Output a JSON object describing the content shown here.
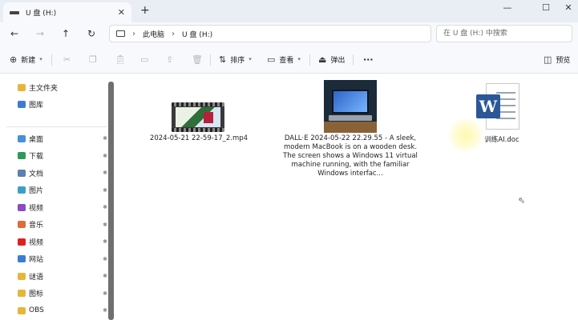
{
  "tab": {
    "title": "U 盘 (H:)",
    "close": "✕",
    "new_tab": "+"
  },
  "window_controls": {
    "minimize": "—",
    "maximize": "☐",
    "close": "✕"
  },
  "nav": {
    "back": "←",
    "forward": "→",
    "up": "↑",
    "refresh": "↻"
  },
  "address": {
    "crumbs": [
      "此电脑",
      "U 盘 (H:)"
    ],
    "chevron": "›"
  },
  "search": {
    "placeholder": "在 U 盘 (H:) 中搜索"
  },
  "commands": {
    "new_label": "新建",
    "sort_label": "排序",
    "view_label": "查看",
    "eject_label": "弹出",
    "more": "···",
    "preview_label": "预览"
  },
  "sidebar": {
    "quick": [
      {
        "label": "主文件夹",
        "icon": "home-icon",
        "color": "#e8b53b"
      },
      {
        "label": "图库",
        "icon": "gallery-icon",
        "color": "#3b7bd8"
      }
    ],
    "pinned": [
      {
        "label": "桌面",
        "icon": "desktop-icon",
        "color": "#4a8fd9"
      },
      {
        "label": "下载",
        "icon": "download-icon",
        "color": "#2d9a5a"
      },
      {
        "label": "文档",
        "icon": "documents-icon",
        "color": "#5b7fae"
      },
      {
        "label": "图片",
        "icon": "pictures-icon",
        "color": "#3aa0c8"
      },
      {
        "label": "视频",
        "icon": "videos-icon",
        "color": "#8a4bc4"
      },
      {
        "label": "音乐",
        "icon": "music-icon",
        "color": "#e06a3a"
      },
      {
        "label": "视频",
        "icon": "youtube-icon",
        "color": "#e02020"
      },
      {
        "label": "网站",
        "icon": "website-icon",
        "color": "#3b7bd8"
      },
      {
        "label": "谜语",
        "icon": "folder-icon",
        "color": "#e8b53b"
      },
      {
        "label": "图标",
        "icon": "icons-folder-icon",
        "color": "#e8b53b"
      },
      {
        "label": "OBS",
        "icon": "folder-icon",
        "color": "#e8b53b"
      }
    ],
    "pin_glyph": "📌"
  },
  "files": [
    {
      "name": "2024-05-21 22-59-17_2.mp4",
      "type": "video"
    },
    {
      "name": "DALL·E 2024-05-22 22.29.55 - A sleek, modern MacBook is on a wooden desk. The screen shows a Windows 11 virtual machine running, with the familiar Windows interfac...",
      "type": "image"
    },
    {
      "name": "训练AI.doc",
      "type": "word-document"
    }
  ],
  "colors": {
    "accent": "#0067c0",
    "word_blue": "#2b5797"
  }
}
